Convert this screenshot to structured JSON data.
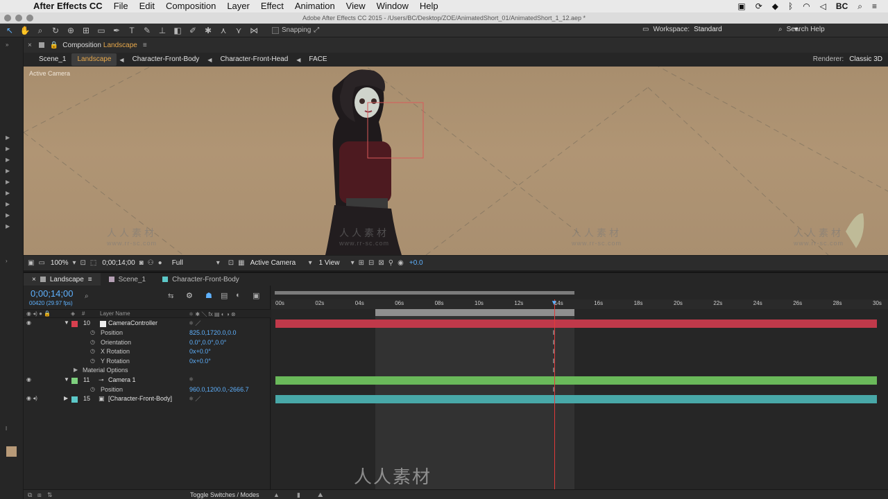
{
  "menubar": {
    "app_name": "After Effects CC",
    "items": [
      "File",
      "Edit",
      "Composition",
      "Layer",
      "Effect",
      "Animation",
      "View",
      "Window",
      "Help"
    ],
    "user": "BC"
  },
  "window": {
    "title": "Adobe After Effects CC 2015 - /Users/BC/Desktop/ZOE/AnimatedShort_01/AnimatedShort_1_12.aep *"
  },
  "toolbar": {
    "snapping_label": "Snapping",
    "workspace_label": "Workspace:",
    "workspace_value": "Standard",
    "search_placeholder": "Search Help"
  },
  "comp_panel": {
    "title_prefix": "Composition",
    "comp_name": "Landscape",
    "breadcrumbs": [
      "Scene_1",
      "Landscape",
      "Character-Front-Body",
      "Character-Front-Head",
      "FACE"
    ],
    "active_crumb_index": 1,
    "renderer_label": "Renderer:",
    "renderer_value": "Classic 3D",
    "viewer_label": "Active Camera",
    "footer": {
      "zoom": "100%",
      "timecode": "0;00;14;00",
      "resolution": "Full",
      "view": "Active Camera",
      "views_count": "1 View",
      "exposure": "+0.0"
    },
    "watermark": "人人素材",
    "watermark_url": "www.rr-sc.com"
  },
  "timeline": {
    "tabs": [
      {
        "label": "Landscape",
        "color": "#a0a0a0"
      },
      {
        "label": "Scene_1",
        "color": "#b5a0b5"
      },
      {
        "label": "Character-Front-Body",
        "color": "#5cc8c8"
      }
    ],
    "timecode": "0;00;14;00",
    "timecode_sub": "00420 (29.97 fps)",
    "search_placeholder": "",
    "column_hash": "#",
    "column_layer_name": "Layer Name",
    "ruler_ticks": [
      "00s",
      "02s",
      "04s",
      "06s",
      "08s",
      "10s",
      "12s",
      "14s",
      "16s",
      "18s",
      "20s",
      "22s",
      "24s",
      "26s",
      "28s",
      "30s"
    ],
    "current_time": 14,
    "work_area": [
      5,
      15
    ],
    "layers": [
      {
        "num": "10",
        "name": "CameraController",
        "color": "#d8404f",
        "track_color": "#c0394a",
        "props": [
          {
            "name": "Position",
            "value": "825.0,1720.0,0.0"
          },
          {
            "name": "Orientation",
            "value": "0.0°,0.0°,0.0°"
          },
          {
            "name": "X Rotation",
            "value": "0x+0.0°"
          },
          {
            "name": "Y Rotation",
            "value": "0x+0.0°"
          }
        ]
      },
      {
        "num": "11",
        "name": "Camera 1",
        "color": "#7ed07e",
        "track_color": "#6ab95a",
        "props": [
          {
            "name": "Position",
            "value": "960.0,1200.0,-2666.7"
          }
        ]
      },
      {
        "num": "15",
        "name": "[Character-Front-Body]",
        "color": "#5cc8c8",
        "track_color": "#48a8a8"
      }
    ],
    "material_options": "Material Options",
    "toggle_label": "Toggle Switches / Modes"
  },
  "colors": {
    "accent_blue": "#5fb2ff",
    "comp_orange": "#e7a84b",
    "cti_red": "#e23a3a"
  }
}
